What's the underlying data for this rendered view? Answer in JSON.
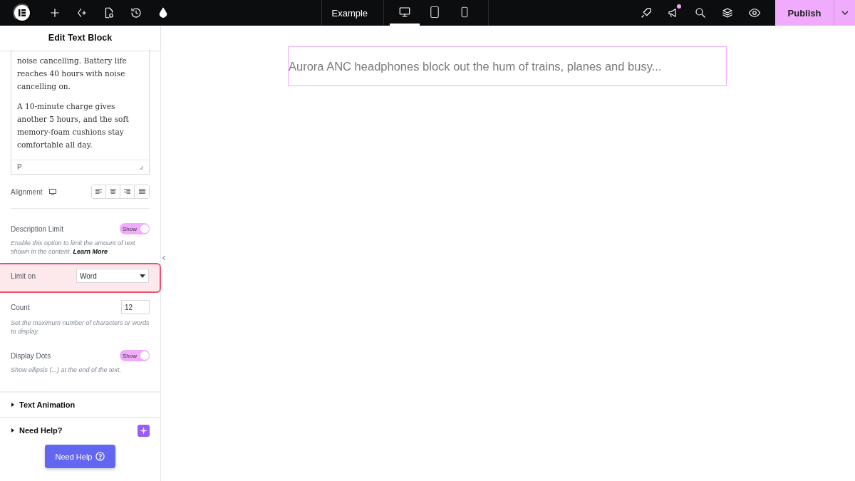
{
  "topbar": {
    "tools": [
      {
        "kind": "add"
      },
      {
        "kind": "ai"
      },
      {
        "kind": "page"
      },
      {
        "kind": "history"
      },
      {
        "kind": "drop"
      }
    ],
    "page_title": "Example",
    "devices": [
      {
        "kind": "desktop",
        "selected": true
      },
      {
        "kind": "tablet",
        "selected": false
      },
      {
        "kind": "mobile",
        "selected": false
      }
    ],
    "right_tools": [
      {
        "kind": "rocket",
        "badge": false
      },
      {
        "kind": "megaphone",
        "badge": true
      },
      {
        "kind": "search",
        "badge": false
      },
      {
        "kind": "layers",
        "badge": false
      },
      {
        "kind": "eye",
        "badge": false
      }
    ],
    "publish": "Publish"
  },
  "panel": {
    "title": "Edit Text Block",
    "editor": {
      "paragraphs": [
        "noise cancelling. Battery life reaches 40 hours with noise cancelling on.",
        "A 10-minute charge gives another 5 hours, and the soft memory-foam cushions stay comfortable all day."
      ],
      "path": "P"
    },
    "alignment": {
      "label": "Alignment",
      "options": [
        {
          "kind": "left",
          "selected": false
        },
        {
          "kind": "center",
          "selected": false
        },
        {
          "kind": "right",
          "selected": false
        },
        {
          "kind": "justify",
          "selected": false
        }
      ]
    },
    "controls": [
      {
        "kind": "toggle",
        "label": "Description Limit",
        "toggle_label": "Show",
        "on": true,
        "help": "Enable this option to limit the amount of text shown in the content.",
        "link": "Learn More",
        "highlighted": false
      },
      {
        "kind": "select",
        "label": "Limit on",
        "value": "Word",
        "highlighted": true
      },
      {
        "kind": "number",
        "label": "Count",
        "value": "12",
        "help": "Set the maximum number of characters or words to display.",
        "highlighted": false
      },
      {
        "kind": "toggle",
        "label": "Display Dots",
        "toggle_label": "Show",
        "on": true,
        "help": "Show ellipsis (...) at the end of the text.",
        "highlighted": false
      }
    ],
    "sections": [
      {
        "label": "Text Animation",
        "expanded": false,
        "ai": false
      },
      {
        "label": "Need Help?",
        "expanded": false,
        "ai": true
      }
    ],
    "help_button": "Need Help"
  },
  "canvas": {
    "text": "Aurora ANC headphones block out the hum of trains, planes and busy..."
  }
}
